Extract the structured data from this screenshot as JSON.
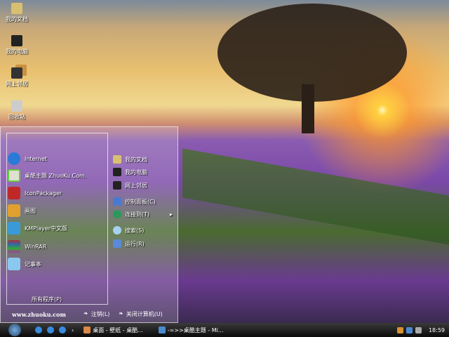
{
  "desktop": {
    "icons": [
      {
        "label": "我的文档",
        "icon": "folder-icon"
      },
      {
        "label": "我的电脑",
        "icon": "computer-icon"
      },
      {
        "label": "网上邻居",
        "icon": "network-icon"
      },
      {
        "label": "回收站",
        "icon": "recycle-bin-icon"
      }
    ]
  },
  "start_menu": {
    "programs": [
      {
        "label": "Internet",
        "icon": "ie-icon"
      },
      {
        "label": "桌酷主题 ZhuoKu.Com.",
        "icon": "theme-icon"
      },
      {
        "label": "IconPackager",
        "icon": "iconpackager-icon"
      },
      {
        "label": "画图",
        "icon": "paint-icon"
      },
      {
        "label": "KMPlayer中文版",
        "icon": "kmplayer-icon"
      },
      {
        "label": "WinRAR",
        "icon": "winrar-icon"
      },
      {
        "label": "记事本",
        "icon": "notepad-icon"
      }
    ],
    "all_programs": "所有程序(P)",
    "places": [
      {
        "label": "我的文档",
        "icon": "folder-icon"
      },
      {
        "label": "我的电脑",
        "icon": "computer-icon"
      },
      {
        "label": "网上邻居",
        "icon": "network-icon"
      },
      {
        "label": "控制面板(C)",
        "icon": "control-panel-icon"
      },
      {
        "label": "连接到(T)",
        "icon": "globe-icon",
        "submenu": true
      },
      {
        "label": "搜索(S)",
        "icon": "search-icon"
      },
      {
        "label": "运行(R)",
        "icon": "run-icon"
      }
    ],
    "website": "www.zhuoku.com",
    "logoff": "注销(L)",
    "shutdown": "关闭计算机(U)",
    "submenu_arrow": "▸"
  },
  "taskbar": {
    "tasks": [
      "桌面 - 壁纸 - 桌酷...",
      "-=>>桌酷主题 - Mi..."
    ],
    "chevron": "›",
    "clock": "18:59"
  }
}
